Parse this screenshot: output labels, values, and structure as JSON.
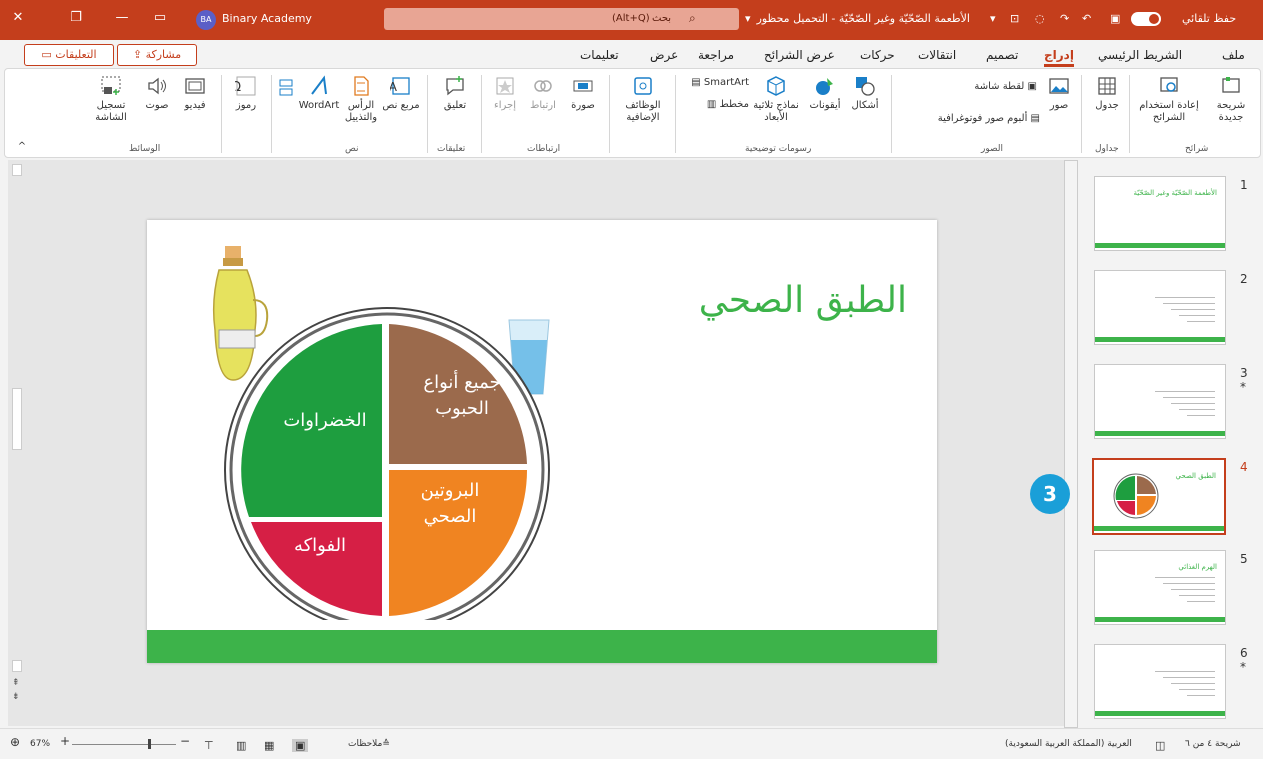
{
  "titlebar": {
    "autosave": "حفظ تلقائي",
    "doc_title": "الأطعمة الصّحّيّة وغير الصّحّيّة - التحميل محظور",
    "search_shortcut": "(Alt+Q)",
    "search_label": "بحث",
    "account_initials": "BA",
    "account_name": "Binary Academy"
  },
  "menu": {
    "tabs": [
      "ملف",
      "الشريط الرئيسي",
      "إدراج",
      "تصميم",
      "انتقالات",
      "حركات",
      "عرض الشرائح",
      "مراجعة",
      "عرض",
      "تعليمات"
    ],
    "active_tab": "إدراج",
    "share_label": "مشاركة",
    "comments_label": "التعليقات"
  },
  "ribbon": {
    "slides": {
      "group": "شرائح",
      "new_slide": "شريحة جديدة",
      "reuse": "إعادة استخدام الشرائح"
    },
    "tables": {
      "group": "جداول",
      "table": "جدول"
    },
    "images": {
      "group": "الصور",
      "pictures": "صور",
      "screenshot": "لقطة شاشة",
      "album": "ألبوم صور فوتوغرافية"
    },
    "illustrations": {
      "group": "رسومات توضيحية",
      "shapes": "أشكال",
      "icons": "أيقونات",
      "models3d": "نماذج ثلاثية الأبعاد",
      "smartart": "SmartArt",
      "chart": "مخطط"
    },
    "addins": {
      "label": "الوظائف الإضافية"
    },
    "links": {
      "group": "ارتباطات",
      "zoom": "صورة",
      "link": "ارتباط",
      "action": "إجراء"
    },
    "comments": {
      "group": "تعليقات",
      "comment": "تعليق"
    },
    "text": {
      "group": "نص",
      "textbox": "مربع نص",
      "header": "الرأس والتذييل",
      "wordart": "WordArt"
    },
    "symbols": {
      "label": "رموز"
    },
    "media": {
      "group": "الوسائط",
      "video": "فيديو",
      "audio": "صوت",
      "screen_record": "تسجيل الشاشة"
    }
  },
  "slide": {
    "title": "الطبق الصحي",
    "sections": {
      "grains": "جميع أنواع الحبوب",
      "vegetables": "الخضراوات",
      "protein": "البروتين الصحي",
      "fruits": "الفواكه"
    },
    "colors": {
      "grains": "#9b6a4c",
      "vegetables": "#1e9e3f",
      "protein": "#f08421",
      "fruits": "#d61f45",
      "bar": "#3db34a",
      "title": "#3db34a"
    }
  },
  "thumbnails": [
    {
      "num": "1",
      "title": "الأطعمة الصّحّيّة وغير الصّحّيّة",
      "star": ""
    },
    {
      "num": "2",
      "title": "",
      "star": ""
    },
    {
      "num": "3",
      "title": "",
      "star": "*"
    },
    {
      "num": "4",
      "title": "الطبق الصحي",
      "star": "",
      "selected": true
    },
    {
      "num": "5",
      "title": "الهرم الغذائي",
      "star": ""
    },
    {
      "num": "6",
      "title": "",
      "star": "*"
    }
  ],
  "callout": "3",
  "status": {
    "slide_count": "شريحة ٤ من ٦",
    "language": "العربية (المملكة العربية السعودية)",
    "notes": "ملاحظات",
    "zoom": "67%"
  }
}
